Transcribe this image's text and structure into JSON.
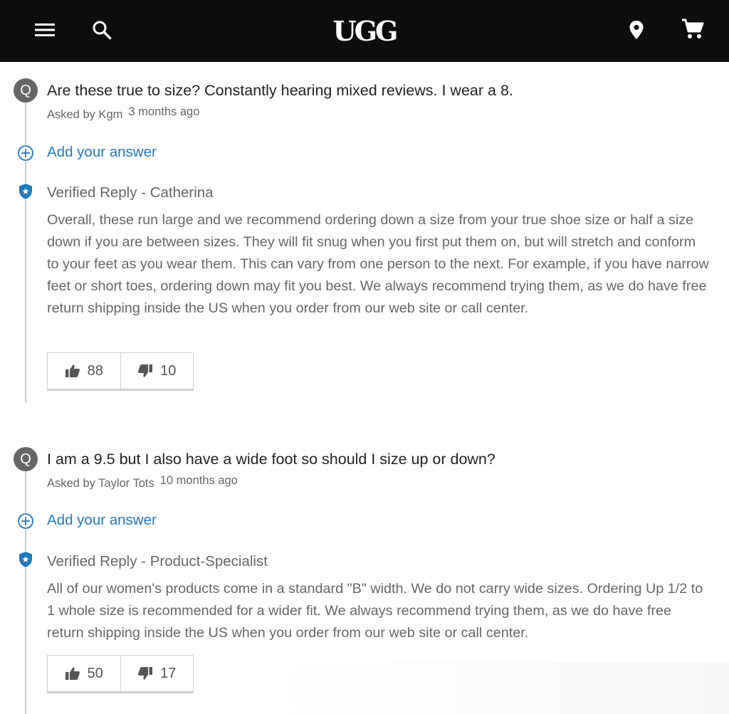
{
  "header": {
    "logo": "UGG",
    "menu_icon": "hamburger-menu-icon",
    "search_icon": "search-icon",
    "location_icon": "location-pin-icon",
    "cart_icon": "shopping-cart-icon"
  },
  "colors": {
    "header_bg": "#0d0d0d",
    "link": "#1f7ac1",
    "badge": "#666666",
    "text_muted": "#666666"
  },
  "questions": [
    {
      "badge": "Q",
      "text": "Are these true to size? Constantly hearing mixed reviews. I wear a 8.",
      "asked_by": "Asked by Kgm",
      "asked_ago": "3 months ago",
      "add_answer": "Add your answer",
      "verified_reply": "Verified Reply - Catherina",
      "answer": "Overall, these run large and we recommend ordering down a size from your true shoe size or half a size down if you are between sizes. They will fit snug when you first put them on, but will stretch and conform to your feet as you wear them. This can vary from one person to the next. For example, if you have narrow feet or short toes, ordering down may fit you best. We always recommend trying them, as we do have free return shipping inside the US when you order from our web site or call center.",
      "helpful_yes": "88",
      "helpful_no": "10"
    },
    {
      "badge": "Q",
      "text": "I am a 9.5 but I also have a wide foot so should I size up or down?",
      "asked_by": "Asked by Taylor Tots",
      "asked_ago": "10 months ago",
      "add_answer": "Add your answer",
      "verified_reply": "Verified Reply - Product-Specialist",
      "answer": "All of our women's products come in a standard \"B\" width. We do not carry wide sizes. Ordering Up 1/2 to 1 whole size is recommended for a wider fit. We always recommend trying them, as we do have free return shipping inside the US when you order from our web site or call center.",
      "helpful_yes": "50",
      "helpful_no": "17"
    }
  ]
}
